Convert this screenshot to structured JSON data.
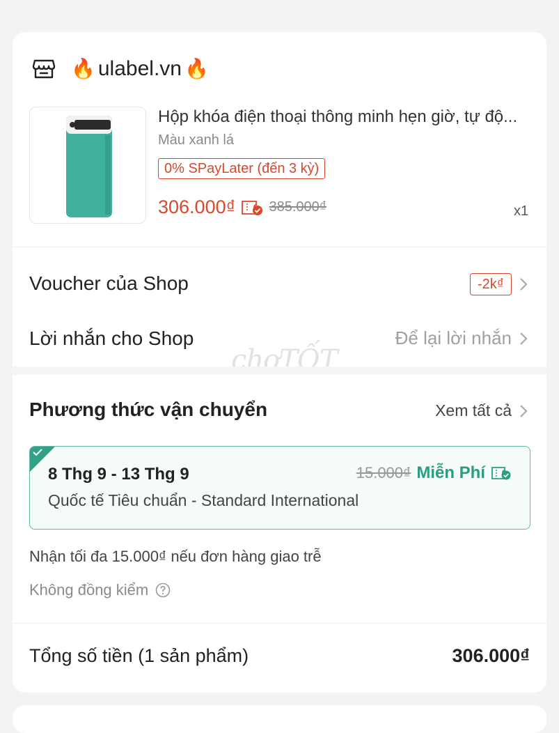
{
  "shop": {
    "name": "ulabel.vn",
    "fire_emoji": "🔥"
  },
  "product": {
    "title": "Hộp khóa điện thoại thông minh hẹn giờ, tự độ...",
    "variant": "Màu xanh lá",
    "badge": "0% SPayLater (đến 3 kỳ)",
    "price": "306.000₫",
    "old_price": "385.000₫",
    "quantity": "x1",
    "image_color": "#3fb19e"
  },
  "voucher": {
    "label": "Voucher của Shop",
    "value": "-2k₫"
  },
  "message": {
    "label": "Lời nhắn cho Shop",
    "placeholder": "Để lại lời nhắn"
  },
  "watermark": "chợTỐT",
  "shipping": {
    "title": "Phương thức vận chuyển",
    "see_all": "Xem tất cả",
    "option": {
      "dates": "8 Thg 9 - 13 Thg 9",
      "name": "Quốc tế Tiêu chuẩn - Standard International",
      "old_fee": "15.000₫",
      "fee": "Miễn Phí",
      "selected": true
    },
    "late_note": "Nhận tối đa 15.000₫ nếu đơn hàng giao trễ",
    "inspection": "Không đồng kiểm"
  },
  "total": {
    "label": "Tổng số tiền (1 sản phẩm)",
    "value": "306.000₫"
  },
  "colors": {
    "accent": "#d9482b",
    "shipping_accent": "#2a9d82"
  }
}
